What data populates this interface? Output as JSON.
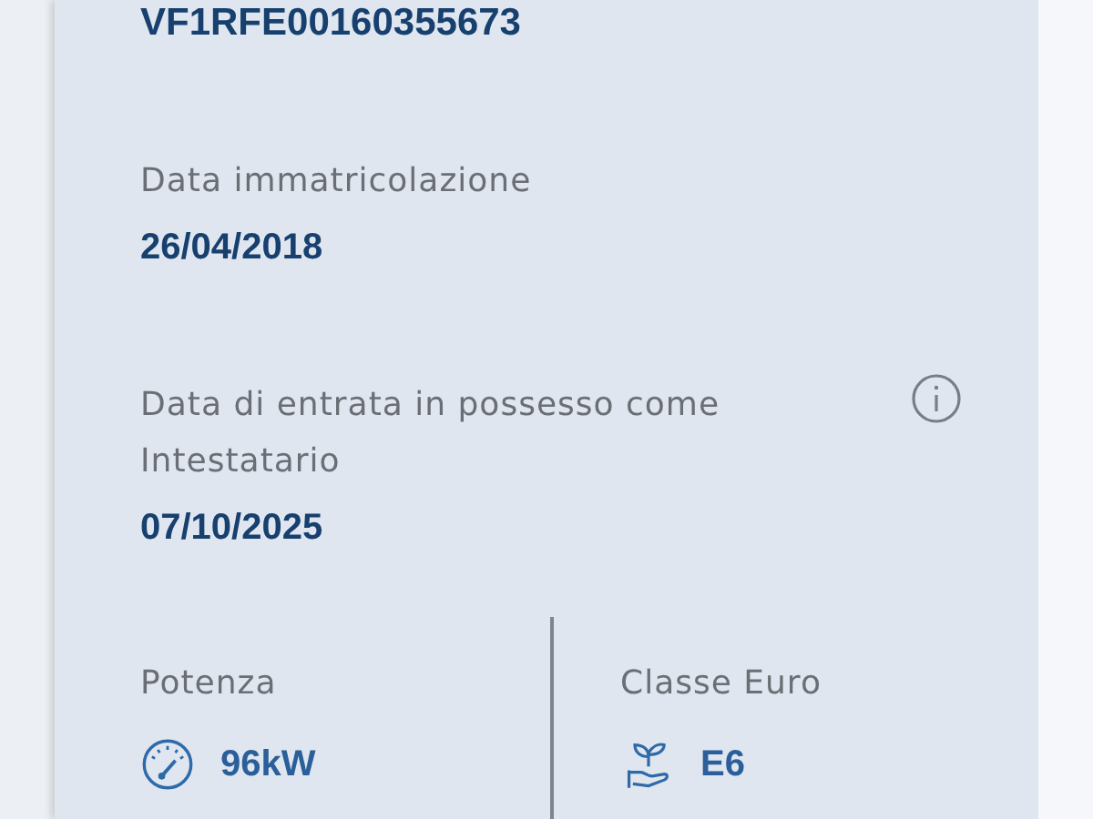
{
  "vin": "VF1RFE00160355673",
  "fields": [
    {
      "label": "Data immatricolazione",
      "value": "26/04/2018",
      "info": false
    },
    {
      "label": "Data di entrata in possesso come Intestatario",
      "value": "07/10/2025",
      "info": true
    }
  ],
  "specs": [
    {
      "kind": "power",
      "label": "Potenza",
      "value": "96kW"
    },
    {
      "kind": "euro",
      "label": "Classe Euro",
      "value": "E6"
    }
  ]
}
